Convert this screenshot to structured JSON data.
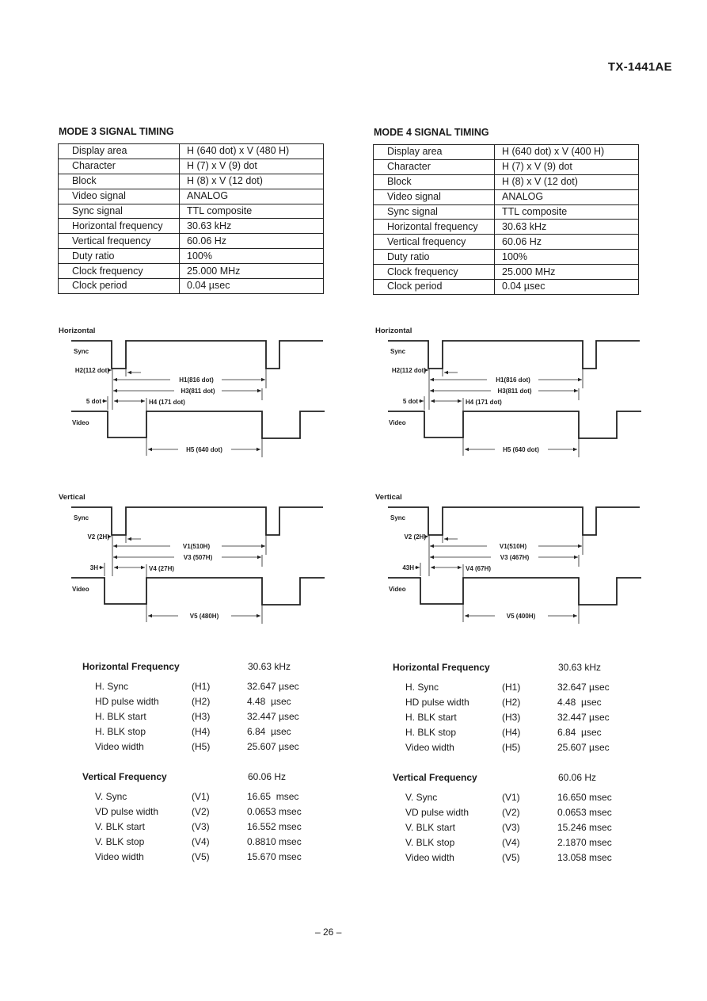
{
  "header": {
    "model": "TX-1441AE"
  },
  "page_number": "– 26 –",
  "modes": [
    {
      "title": "MODE 3 SIGNAL TIMING",
      "spec_table": [
        {
          "label": "Display area",
          "value": "H (640 dot) x V (480 H)"
        },
        {
          "label": "Character",
          "value": "H (7) x V (9) dot"
        },
        {
          "label": "Block",
          "value": "H (8) x V (12 dot)"
        },
        {
          "label": "Video signal",
          "value": "ANALOG"
        },
        {
          "label": "Sync signal",
          "value": "TTL composite"
        },
        {
          "label": "Horizontal frequency",
          "value": "30.63 kHz"
        },
        {
          "label": "Vertical frequency",
          "value": "60.06 Hz"
        },
        {
          "label": "Duty ratio",
          "value": "100%"
        },
        {
          "label": "Clock frequency",
          "value": "25.000 MHz"
        },
        {
          "label": "Clock period",
          "value": "0.04 µsec"
        }
      ],
      "horizontal_diagram": {
        "title": "Horizontal",
        "sync_label": "Sync",
        "video_label": "Video",
        "p2": "H2(112 dot)",
        "p1": "H1(816 dot)",
        "p3": "H3(811 dot)",
        "offset": "5 dot",
        "p4": "H4 (171 dot)",
        "p5": "H5 (640 dot)"
      },
      "vertical_diagram": {
        "title": "Vertical",
        "sync_label": "Sync",
        "video_label": "Video",
        "p2": "V2 (2H)",
        "p1": "V1(510H)",
        "p3": "V3 (507H)",
        "offset": "3H",
        "p4": "V4 (27H)",
        "p5": "V5 (480H)"
      },
      "horizontal_frequency": {
        "label": "Horizontal Frequency",
        "value": "30.63 kHz",
        "rows": [
          {
            "name": "H. Sync",
            "code": "(H1)",
            "value": "32.647 µsec"
          },
          {
            "name": "HD pulse width",
            "code": "(H2)",
            "value": "4.48  µsec"
          },
          {
            "name": "H. BLK start",
            "code": "(H3)",
            "value": "32.447 µsec"
          },
          {
            "name": "H. BLK stop",
            "code": "(H4)",
            "value": "6.84  µsec"
          },
          {
            "name": "Video width",
            "code": "(H5)",
            "value": "25.607 µsec"
          }
        ]
      },
      "vertical_frequency": {
        "label": "Vertical Frequency",
        "value": "60.06 Hz",
        "rows": [
          {
            "name": "V. Sync",
            "code": "(V1)",
            "value": "16.65  msec"
          },
          {
            "name": "VD pulse width",
            "code": "(V2)",
            "value": "0.0653 msec"
          },
          {
            "name": "V. BLK start",
            "code": "(V3)",
            "value": "16.552 msec"
          },
          {
            "name": "V. BLK stop",
            "code": "(V4)",
            "value": "0.8810 msec"
          },
          {
            "name": "Video width",
            "code": "(V5)",
            "value": "15.670 msec"
          }
        ]
      }
    },
    {
      "title": "MODE 4 SIGNAL TIMING",
      "spec_table": [
        {
          "label": "Display area",
          "value": "H (640 dot) x V (400 H)"
        },
        {
          "label": "Character",
          "value": "H (7) x V (9) dot"
        },
        {
          "label": "Block",
          "value": "H (8) x V (12 dot)"
        },
        {
          "label": "Video signal",
          "value": "ANALOG"
        },
        {
          "label": "Sync signal",
          "value": "TTL composite"
        },
        {
          "label": "Horizontal frequency",
          "value": "30.63 kHz"
        },
        {
          "label": "Vertical frequency",
          "value": "60.06 Hz"
        },
        {
          "label": "Duty ratio",
          "value": "100%"
        },
        {
          "label": "Clock frequency",
          "value": "25.000 MHz"
        },
        {
          "label": "Clock period",
          "value": "0.04 µsec"
        }
      ],
      "horizontal_diagram": {
        "title": "Horizontal",
        "sync_label": "Sync",
        "video_label": "Video",
        "p2": "H2(112 dot)",
        "p1": "H1(816 dot)",
        "p3": "H3(811 dot)",
        "offset": "5 dot",
        "p4": "H4 (171 dot)",
        "p5": "H5 (640 dot)"
      },
      "vertical_diagram": {
        "title": "Vertical",
        "sync_label": "Sync",
        "video_label": "Video",
        "p2": "V2 (2H)",
        "p1": "V1(510H)",
        "p3": "V3 (467H)",
        "offset": "43H",
        "p4": "V4 (67H)",
        "p5": "V5 (400H)"
      },
      "horizontal_frequency": {
        "label": "Horizontal Frequency",
        "value": "30.63 kHz",
        "rows": [
          {
            "name": "H. Sync",
            "code": "(H1)",
            "value": "32.647 µsec"
          },
          {
            "name": "HD pulse width",
            "code": "(H2)",
            "value": "4.48  µsec"
          },
          {
            "name": "H. BLK start",
            "code": "(H3)",
            "value": "32.447 µsec"
          },
          {
            "name": "H. BLK stop",
            "code": "(H4)",
            "value": "6.84  µsec"
          },
          {
            "name": "Video width",
            "code": "(H5)",
            "value": "25.607 µsec"
          }
        ]
      },
      "vertical_frequency": {
        "label": "Vertical Frequency",
        "value": "60.06 Hz",
        "rows": [
          {
            "name": "V. Sync",
            "code": "(V1)",
            "value": "16.650 msec"
          },
          {
            "name": "VD pulse width",
            "code": "(V2)",
            "value": "0.0653 msec"
          },
          {
            "name": "V. BLK start",
            "code": "(V3)",
            "value": "15.246 msec"
          },
          {
            "name": "V. BLK stop",
            "code": "(V4)",
            "value": "2.1870 msec"
          },
          {
            "name": "Video width",
            "code": "(V5)",
            "value": "13.058 msec"
          }
        ]
      }
    }
  ]
}
